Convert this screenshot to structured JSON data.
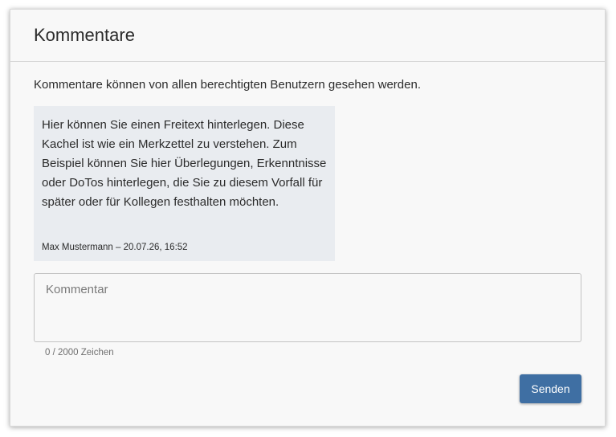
{
  "panel": {
    "title": "Kommentare",
    "info": "Kommentare können von allen berechtigten Benutzern gesehen werden."
  },
  "comments": [
    {
      "text": "Hier können Sie einen Freitext hinterlegen. Diese Kachel ist wie ein Merkzettel zu verstehen. Zum Beispiel können Sie hier Überlegungen, Erkenntnisse oder DoTos hinterlegen, die Sie zu diesem Vorfall für später oder für Kollegen festhalten möchten.",
      "meta": "Max Mustermann – 20.07.26, 16:52"
    }
  ],
  "input": {
    "placeholder": "Kommentar",
    "value": "",
    "counter": "0 / 2000 Zeichen"
  },
  "actions": {
    "send_label": "Senden"
  },
  "colors": {
    "accent": "#3f6fa3",
    "bubble": "#e9ecf0"
  }
}
